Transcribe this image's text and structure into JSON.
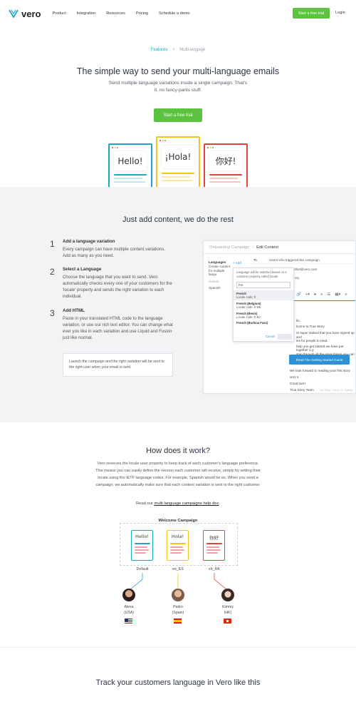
{
  "nav": {
    "logo": "vero",
    "links": [
      "Product",
      "Integration",
      "Resources",
      "Pricing",
      "Schedule a demo"
    ],
    "cta": "Start a free trial",
    "login": "Login"
  },
  "breadcrumb": {
    "parent": "Features",
    "sep": ">",
    "current": "Multi-langage"
  },
  "hero": {
    "title": "The simple way to send your multi-language emails",
    "subtitle": "Send multiple language variations inside a single campaign. That's it, no fancy-pants stuff.",
    "cta": "Start a free trial",
    "cards": [
      "Hello!",
      "¡Hola!",
      "你好!"
    ]
  },
  "content": {
    "title": "Just add content, we do the rest",
    "steps": [
      {
        "num": "1",
        "title": "Add a language variation",
        "desc": "Every campaign can have multiple content variations. Add as many as you need."
      },
      {
        "num": "2",
        "title": "Select a Language",
        "desc": "Choose the language that you want to send. Vero automatically checks every one of your customers for the 'locale' property and sends the right variation to each individual."
      },
      {
        "num": "3",
        "title": "Add HTML",
        "desc": "Paste in your translated HTML code to the language variation, or use our rich text editor. You can change what ever you like in each variation and use Liquid and Fusion just like normal."
      }
    ],
    "note": "Launch the campaign and the right variation will be sent to the right user when your email is sent."
  },
  "app": {
    "crumb1": "Onboarding Campaign",
    "crumb2": "Edit Content",
    "languages_label": "Languages",
    "add": "+ Add",
    "create_text": "Create content for multiple langu",
    "default": "Default",
    "spanish": "Spanish",
    "to_label": "To",
    "to_value": "Users who triggered this campaign",
    "from_value": "zelliot@vero.com",
    "subject_tail": "ory",
    "dropdown_hint": "Language will be matched based on a customer property called locale.",
    "search": "Fre",
    "options": [
      {
        "name": "French",
        "code": "Locale code: fr"
      },
      {
        "name": "French (Belgium)",
        "code": "Locale code: fr-BE"
      },
      {
        "name": "French (Benin)",
        "code": "Locale code: fr-BJ"
      },
      {
        "name": "French (Burkina Faso)",
        "code": ""
      }
    ],
    "cancel": "Cancel",
    "email": {
      "greeting": "llo,",
      "l1": "lcome to True Story",
      "l2": "re super stoked that you have signed up and",
      "l3": "ies for people to read.",
      "l4": "help you get started we have put together a g",
      "l5": "step through all the great things you can do on",
      "button": "Read The Getting Started Guide",
      "l6": "We look forward to reading your first story very s",
      "l7": "Good luck!",
      "l8": "True Story Team",
      "footer": "True Story, 1 Story St, Sydney"
    }
  },
  "how": {
    "title": "How does it work?",
    "body": "Vero reserves the locale user property to keep track of each customer's language preference. This means you can easily define the version each customer will receive, simply by setting their locale using the IETF language codes. For example, Spanish would be es. When you send a campaign, we automatically make sure that each content variation is sent to the right customer.",
    "read_prefix": "Read our",
    "read_link": "multi language campaigns help doc",
    "read_suffix": ".",
    "campaign_title": "Welcome Campaign",
    "variants": [
      {
        "greet": "Hello!",
        "locale": "Default",
        "person": "Alexa",
        "country": "(USA)",
        "color": "#1aa8c4"
      },
      {
        "greet": "Hola!",
        "locale": "es_ES",
        "person": "Pedro",
        "country": "(Spain)",
        "color": "#f5c518"
      },
      {
        "greet": "你好",
        "locale": "zh_HK",
        "person": "Kimmy",
        "country": "(HK)",
        "color": "#e0433d"
      }
    ]
  },
  "bottom": {
    "title": "Track your customers language in Vero like this"
  },
  "colors": {
    "green": "#5cc23f",
    "teal": "#1aa8c4",
    "yellow": "#f5c518",
    "red": "#e0433d",
    "blue": "#2f90d6"
  }
}
